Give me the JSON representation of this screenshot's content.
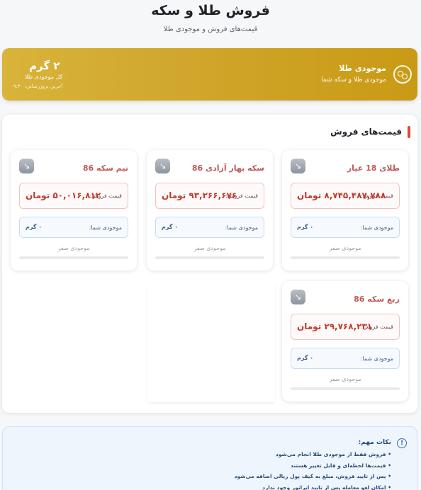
{
  "header": {
    "title": "فروش طلا و سکه",
    "subtitle": "قیمت‌های فروش و موجودی طلا"
  },
  "banner": {
    "label": "موجودی طلا",
    "description": "موجودی طلا و سکه شما",
    "amount": "۲ گرم",
    "amount_label": "کل موجودی طلا",
    "last_update": "آخرین بروزرسانی: ۰۹:۴۰",
    "icon": "coins-icon"
  },
  "prices_section": {
    "title": "قیمت‌های فروش",
    "price_label": "قیمت فروش:",
    "stock_label": "موجودی شما:",
    "zero_stock_text": "موجودی صفر",
    "cards": [
      {
        "name": "طلای 18 عیار",
        "price": "۸,۷۴۵,۴۸۷,۷۸۸ تومان",
        "stock": "۰ گرم",
        "progress": 0
      },
      {
        "name": "سکه بهار آزادی 86",
        "price": "۹۳,۲۶۶,۶۷۶ تومان",
        "stock": "۰ گرم",
        "progress": 0
      },
      {
        "name": "نیم سکه 86",
        "price": "۵۰,۰۱۶,۸۱۲ تومان",
        "stock": "۰ گرم",
        "progress": 0
      },
      {
        "name": "ربع سکه 86",
        "price": "۲۹,۷۶۸,۲۳۱ تومان",
        "stock": "۰ گرم",
        "progress": 0
      }
    ]
  },
  "notes": {
    "title": "نکات مهم:",
    "items": [
      "فروش فقط از موجودی طلا انجام می‌شود",
      "قیمت‌ها لحظه‌ای و قابل تغییر هستند",
      "پس از تایید فروش، مبلغ به کیف پول ریالی اضافه می‌شود",
      "امکان لغو معامله پس از تایید اپراتور وجود ندارد"
    ]
  },
  "colors": {
    "gold": "#cfa52a",
    "accent_red": "#e0463b",
    "price_red": "#c0392b",
    "stock_blue": "#3d5a85"
  }
}
